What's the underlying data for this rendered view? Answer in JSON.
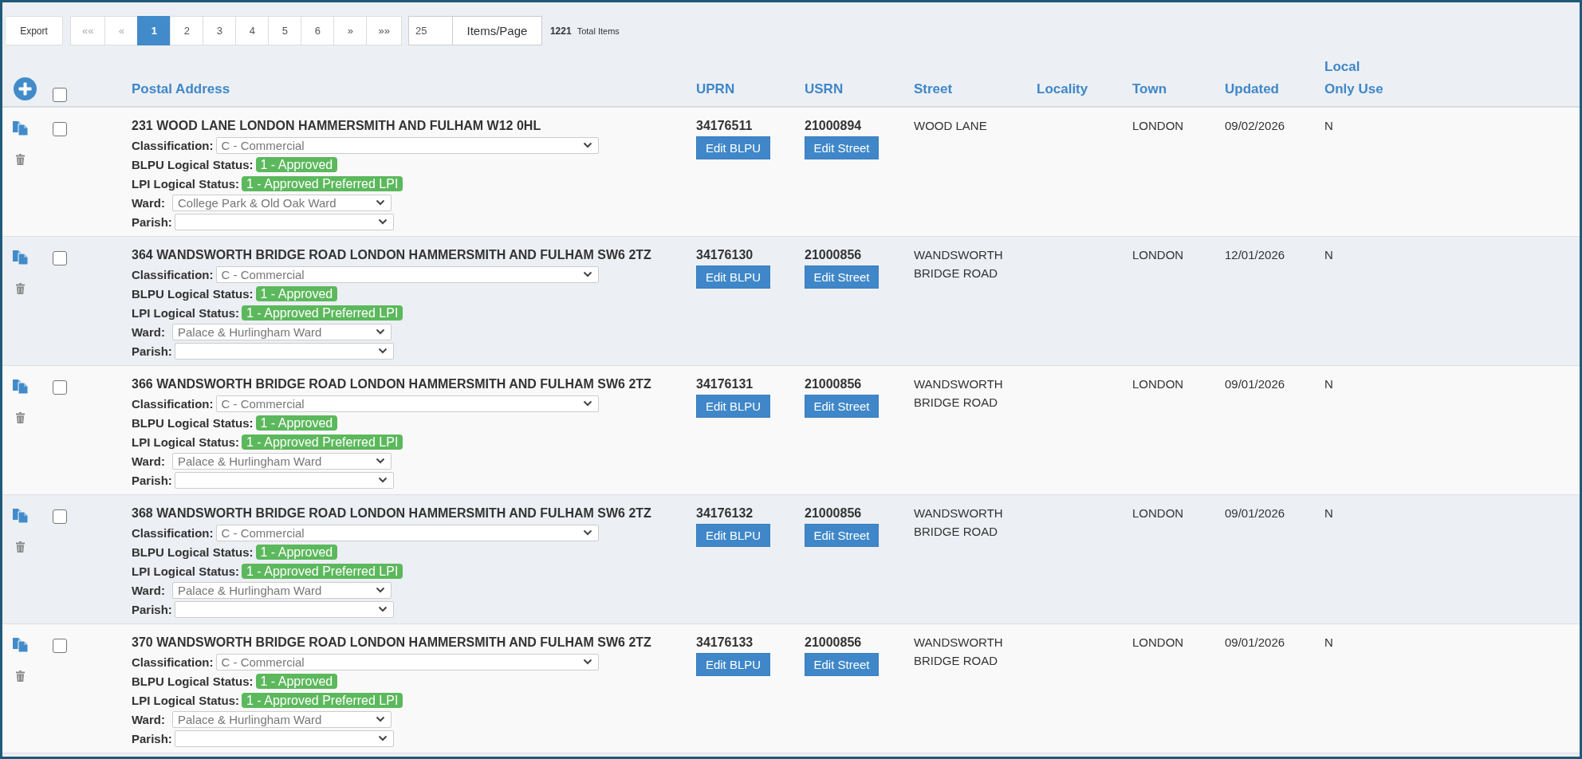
{
  "toolbar": {
    "export_button": "Export",
    "pagination": [
      {
        "label": "««",
        "selected": false,
        "disabled": true
      },
      {
        "label": "«",
        "selected": false,
        "disabled": true
      },
      {
        "label": "1",
        "selected": true,
        "disabled": false
      },
      {
        "label": "2",
        "selected": false,
        "disabled": false
      },
      {
        "label": "3",
        "selected": false,
        "disabled": false
      },
      {
        "label": "4",
        "selected": false,
        "disabled": false
      },
      {
        "label": "5",
        "selected": false,
        "disabled": false
      },
      {
        "label": "6",
        "selected": false,
        "disabled": false
      },
      {
        "label": "»",
        "selected": false,
        "disabled": false
      },
      {
        "label": "»»",
        "selected": false,
        "disabled": false
      }
    ],
    "page_size": "25",
    "page_size_button": "Items/Page",
    "total_count": "1221",
    "total_label": "Total Items"
  },
  "table": {
    "select_all_checked": false,
    "columns": [
      "Postal Address",
      "UPRN",
      "USRN",
      "Street",
      "Locality",
      "Town",
      "Updated",
      "Local Only Use"
    ],
    "rows": [
      {
        "checked": false,
        "postal_address": "231 WOOD LANE LONDON HAMMERSMITH AND FULHAM W12 0HL",
        "fields": [
          {
            "kind": "dropdown",
            "label": "Classification:",
            "value": "C - Commercial"
          },
          {
            "kind": "badge",
            "label": "BLPU Logical Status:",
            "value": "1 - Approved"
          },
          {
            "kind": "badge",
            "label": "LPI Logical Status:",
            "value": "1 - Approved Preferred LPI"
          },
          {
            "kind": "dropdown",
            "label": "Ward:",
            "value": "College Park & Old Oak Ward"
          },
          {
            "kind": "dropdown",
            "label": "Parish:"
          }
        ],
        "uprn": "34176511",
        "edit_blpu_button": "Edit BLPU",
        "usrn": "21000894",
        "edit_street_button": "Edit Street",
        "street": "WOOD LANE",
        "town": "LONDON",
        "updated": "09/02/2026",
        "local_only_use": "N"
      },
      {
        "checked": false,
        "postal_address": "364 WANDSWORTH BRIDGE ROAD LONDON HAMMERSMITH AND FULHAM SW6 2TZ",
        "fields": [
          {
            "kind": "dropdown",
            "label": "Classification:",
            "value": "C - Commercial"
          },
          {
            "kind": "badge",
            "label": "BLPU Logical Status:",
            "value": "1 - Approved"
          },
          {
            "kind": "badge",
            "label": "LPI Logical Status:",
            "value": "1 - Approved Preferred LPI"
          },
          {
            "kind": "dropdown",
            "label": "Ward:",
            "value": "Palace & Hurlingham Ward"
          },
          {
            "kind": "dropdown",
            "label": "Parish:"
          }
        ],
        "uprn": "34176130",
        "edit_blpu_button": "Edit BLPU",
        "usrn": "21000856",
        "edit_street_button": "Edit Street",
        "street": "WANDSWORTH BRIDGE ROAD",
        "town": "LONDON",
        "updated": "12/01/2026",
        "local_only_use": "N"
      },
      {
        "checked": false,
        "postal_address": "366 WANDSWORTH BRIDGE ROAD LONDON HAMMERSMITH AND FULHAM SW6 2TZ",
        "fields": [
          {
            "kind": "dropdown",
            "label": "Classification:",
            "value": "C - Commercial"
          },
          {
            "kind": "badge",
            "label": "BLPU Logical Status:",
            "value": "1 - Approved"
          },
          {
            "kind": "badge",
            "label": "LPI Logical Status:",
            "value": "1 - Approved Preferred LPI"
          },
          {
            "kind": "dropdown",
            "label": "Ward:",
            "value": "Palace & Hurlingham Ward"
          },
          {
            "kind": "dropdown",
            "label": "Parish:"
          }
        ],
        "uprn": "34176131",
        "edit_blpu_button": "Edit BLPU",
        "usrn": "21000856",
        "edit_street_button": "Edit Street",
        "street": "WANDSWORTH BRIDGE ROAD",
        "town": "LONDON",
        "updated": "09/01/2026",
        "local_only_use": "N"
      },
      {
        "checked": false,
        "postal_address": "368 WANDSWORTH BRIDGE ROAD LONDON HAMMERSMITH AND FULHAM SW6 2TZ",
        "fields": [
          {
            "kind": "dropdown",
            "label": "Classification:",
            "value": "C - Commercial"
          },
          {
            "kind": "badge",
            "label": "BLPU Logical Status:",
            "value": "1 - Approved"
          },
          {
            "kind": "badge",
            "label": "LPI Logical Status:",
            "value": "1 - Approved Preferred LPI"
          },
          {
            "kind": "dropdown",
            "label": "Ward:",
            "value": "Palace & Hurlingham Ward"
          },
          {
            "kind": "dropdown",
            "label": "Parish:"
          }
        ],
        "uprn": "34176132",
        "edit_blpu_button": "Edit BLPU",
        "usrn": "21000856",
        "edit_street_button": "Edit Street",
        "street": "WANDSWORTH BRIDGE ROAD",
        "town": "LONDON",
        "updated": "09/01/2026",
        "local_only_use": "N"
      },
      {
        "checked": false,
        "postal_address": "370 WANDSWORTH BRIDGE ROAD LONDON HAMMERSMITH AND FULHAM SW6 2TZ",
        "fields": [
          {
            "kind": "dropdown",
            "label": "Classification:",
            "value": "C - Commercial"
          },
          {
            "kind": "badge",
            "label": "BLPU Logical Status:",
            "value": "1 - Approved"
          },
          {
            "kind": "badge",
            "label": "LPI Logical Status:",
            "value": "1 - Approved Preferred LPI"
          },
          {
            "kind": "dropdown",
            "label": "Ward:",
            "value": "Palace & Hurlingham Ward"
          },
          {
            "kind": "dropdown",
            "label": "Parish:"
          }
        ],
        "uprn": "34176133",
        "edit_blpu_button": "Edit BLPU",
        "usrn": "21000856",
        "edit_street_button": "Edit Street",
        "street": "WANDSWORTH BRIDGE ROAD",
        "town": "LONDON",
        "updated": "09/01/2026",
        "local_only_use": "N"
      }
    ]
  }
}
